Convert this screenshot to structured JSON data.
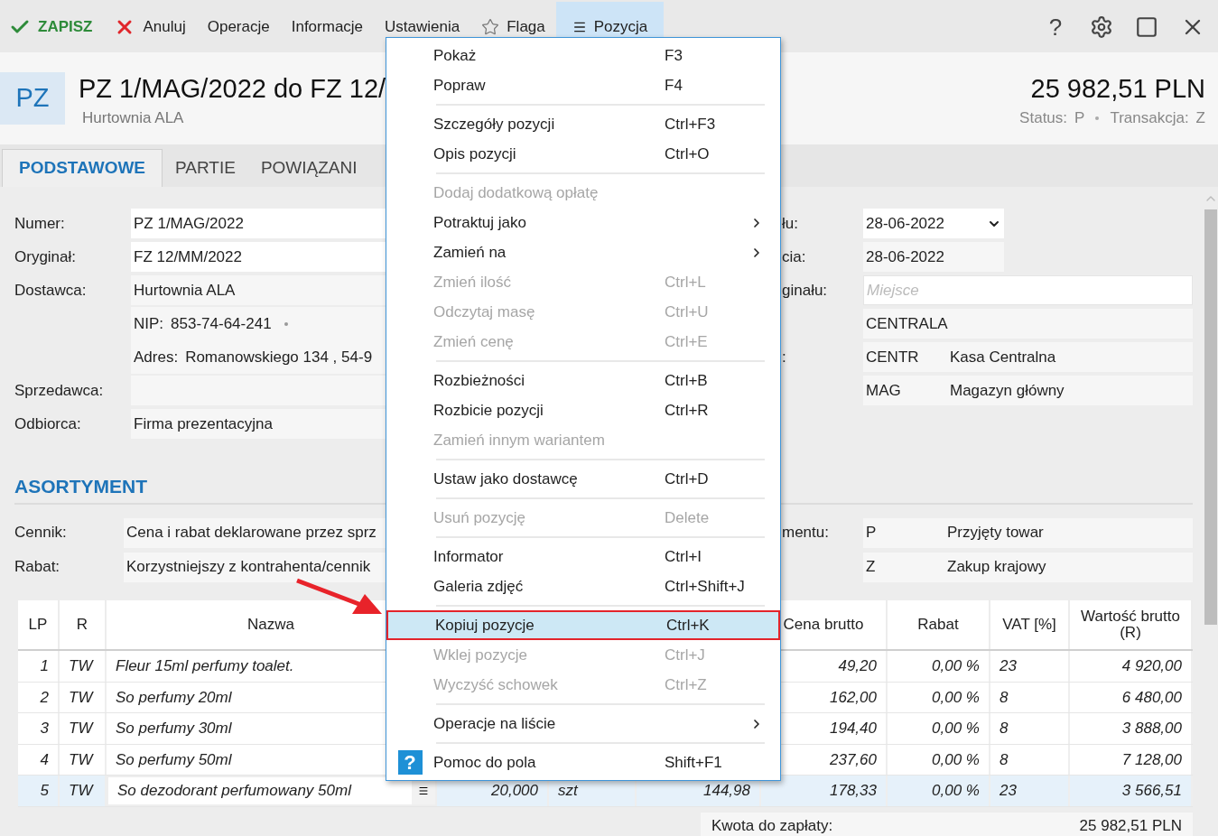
{
  "toolbar": {
    "items": [
      {
        "label": "ZAPISZ",
        "kind": "save",
        "selected": false
      },
      {
        "label": "Anuluj",
        "kind": "cancel",
        "selected": false
      },
      {
        "label": "Operacje",
        "kind": "plain",
        "selected": false
      },
      {
        "label": "Informacje",
        "kind": "plain",
        "selected": false
      },
      {
        "label": "Ustawienia",
        "kind": "plain",
        "selected": false
      },
      {
        "label": "Flaga",
        "kind": "flag",
        "selected": false
      },
      {
        "label": "Pozycja",
        "kind": "list",
        "selected": true
      }
    ],
    "help": "?"
  },
  "header": {
    "badge": "PZ",
    "title": "PZ 1/MAG/2022 do FZ 12/",
    "subtitle": "Hurtownia ALA",
    "total": "25 982,51 PLN",
    "status_label": "Status:",
    "status_value": "P",
    "transaction_label": "Transakcja:",
    "transaction_value": "Z"
  },
  "tabs": [
    {
      "label": "PODSTAWOWE",
      "selected": true
    },
    {
      "label": "PARTIE",
      "selected": false
    },
    {
      "label": "POWIĄZANI",
      "selected": false
    }
  ],
  "form_left": [
    {
      "label": "Numer:",
      "value": "PZ 1/MAG/2022",
      "kind": "input"
    },
    {
      "label": "Oryginał:",
      "value": "FZ 12/MM/2022",
      "kind": "input"
    },
    {
      "label": "Dostawca:",
      "value": "Hurtownia ALA",
      "kind": "readonly"
    },
    {
      "kind": "detail",
      "key": "NIP:",
      "value": "853-74-64-241",
      "dot": true
    },
    {
      "kind": "detail",
      "key": "Adres:",
      "value": "Romanowskiego 134 , 54-9",
      "dot": false
    },
    {
      "label": "Sprzedawca:",
      "kind": "readonly"
    },
    {
      "label": "Odbiorca:",
      "value": "Firma prezentacyjna",
      "kind": "readonly"
    }
  ],
  "form_right": [
    {
      "label": "łu:",
      "value": "28-06-2022",
      "kind": "date_picker"
    },
    {
      "label": "cia:",
      "value": "28-06-2022",
      "kind": "date"
    },
    {
      "label": "ginału:",
      "placeholder": "Miejsce",
      "kind": "input"
    },
    {
      "value": "CENTRALA",
      "kind": "readonly"
    },
    {
      "label": ":",
      "code": "CENTR",
      "value": "Kasa Centralna",
      "kind": "coded"
    },
    {
      "code": "MAG",
      "value": "Magazyn główny",
      "kind": "coded"
    }
  ],
  "section_title": "ASORTYMENT",
  "assortment_left": [
    {
      "label": "Cennik:",
      "value": "Cena i rabat deklarowane przez sprz"
    },
    {
      "label": "Rabat:",
      "value": "Korzystniejszy z kontrahenta/cennik"
    }
  ],
  "assortment_right": [
    {
      "label": "mentu:",
      "code": "P",
      "value": "Przyjęty towar"
    },
    {
      "code": "Z",
      "value": "Zakup krajowy"
    }
  ],
  "table": {
    "columns": {
      "lp": "LP",
      "r": "R",
      "name": "Nazwa",
      "gross_price": "Cena brutto",
      "discount": "Rabat",
      "vat": "VAT [%]",
      "gross_value": "Wartość brutto (R)"
    },
    "rows": [
      {
        "lp": "1",
        "r": "TW",
        "name": "Fleur 15ml perfumy toalet.",
        "gross_price": "49,20",
        "discount": "0,00 %",
        "vat": "23",
        "gross_value": "4 920,00",
        "selected": false
      },
      {
        "lp": "2",
        "r": "TW",
        "name": "So perfumy 20ml",
        "gross_price": "162,00",
        "discount": "0,00 %",
        "vat": "8",
        "gross_value": "6 480,00",
        "selected": false
      },
      {
        "lp": "3",
        "r": "TW",
        "name": "So perfumy 30ml",
        "gross_price": "194,40",
        "discount": "0,00 %",
        "vat": "8",
        "gross_value": "3 888,00",
        "selected": false
      },
      {
        "lp": "4",
        "r": "TW",
        "name": "So perfumy 50ml",
        "gross_price": "237,60",
        "discount": "0,00 %",
        "vat": "8",
        "gross_value": "7 128,00",
        "selected": false
      },
      {
        "lp": "5",
        "r": "TW",
        "name": "So dezodorant perfumowany 50ml",
        "column_4": "20,000",
        "column_5": "szt",
        "column_6": "144,98",
        "gross_price": "178,33",
        "discount": "0,00 %",
        "vat": "23",
        "gross_value": "3 566,51",
        "selected": true
      }
    ]
  },
  "footer": {
    "label": "Kwota do zapłaty:",
    "value": "25 982,51 PLN"
  },
  "context_menu": [
    {
      "kind": "item",
      "label": "Pokaż",
      "shortcut": "F3",
      "disabled": false,
      "submenu": false,
      "selected": false
    },
    {
      "kind": "item",
      "label": "Popraw",
      "shortcut": "F4",
      "disabled": false,
      "submenu": false,
      "selected": false
    },
    {
      "kind": "separator"
    },
    {
      "kind": "item",
      "label": "Szczegóły pozycji",
      "shortcut": "Ctrl+F3",
      "disabled": false,
      "submenu": false,
      "selected": false
    },
    {
      "kind": "item",
      "label": "Opis pozycji",
      "shortcut": "Ctrl+O",
      "disabled": false,
      "submenu": false,
      "selected": false
    },
    {
      "kind": "separator"
    },
    {
      "kind": "item",
      "label": "Dodaj dodatkową opłatę",
      "disabled": true,
      "submenu": false,
      "selected": false
    },
    {
      "kind": "item",
      "label": "Potraktuj jako",
      "disabled": false,
      "submenu": true,
      "selected": false
    },
    {
      "kind": "item",
      "label": "Zamień na",
      "disabled": false,
      "submenu": true,
      "selected": false
    },
    {
      "kind": "item",
      "label": "Zmień ilość",
      "shortcut": "Ctrl+L",
      "disabled": true,
      "submenu": false,
      "selected": false
    },
    {
      "kind": "item",
      "label": "Odczytaj masę",
      "shortcut": "Ctrl+U",
      "disabled": true,
      "submenu": false,
      "selected": false
    },
    {
      "kind": "item",
      "label": "Zmień cenę",
      "shortcut": "Ctrl+E",
      "disabled": true,
      "submenu": false,
      "selected": false
    },
    {
      "kind": "separator"
    },
    {
      "kind": "item",
      "label": "Rozbieżności",
      "shortcut": "Ctrl+B",
      "disabled": false,
      "submenu": false,
      "selected": false
    },
    {
      "kind": "item",
      "label": "Rozbicie pozycji",
      "shortcut": "Ctrl+R",
      "disabled": false,
      "submenu": false,
      "selected": false
    },
    {
      "kind": "item",
      "label": "Zamień innym wariantem",
      "disabled": true,
      "submenu": false,
      "selected": false
    },
    {
      "kind": "separator"
    },
    {
      "kind": "item",
      "label": "Ustaw jako dostawcę",
      "shortcut": "Ctrl+D",
      "disabled": false,
      "submenu": false,
      "selected": false
    },
    {
      "kind": "separator"
    },
    {
      "kind": "item",
      "label": "Usuń pozycję",
      "shortcut": "Delete",
      "disabled": true,
      "submenu": false,
      "selected": false
    },
    {
      "kind": "separator"
    },
    {
      "kind": "item",
      "label": "Informator",
      "shortcut": "Ctrl+I",
      "disabled": false,
      "submenu": false,
      "selected": false
    },
    {
      "kind": "item",
      "label": "Galeria zdjęć",
      "shortcut": "Ctrl+Shift+J",
      "disabled": false,
      "submenu": false,
      "selected": false
    },
    {
      "kind": "separator"
    },
    {
      "kind": "item",
      "label": "Kopiuj pozycje",
      "shortcut": "Ctrl+K",
      "disabled": false,
      "submenu": false,
      "selected": true
    },
    {
      "kind": "item",
      "label": "Wklej pozycje",
      "shortcut": "Ctrl+J",
      "disabled": true,
      "submenu": false,
      "selected": false
    },
    {
      "kind": "item",
      "label": "Wyczyść schowek",
      "shortcut": "Ctrl+Z",
      "disabled": true,
      "submenu": false,
      "selected": false
    },
    {
      "kind": "separator"
    },
    {
      "kind": "item",
      "label": "Operacje na liście",
      "disabled": false,
      "submenu": true,
      "selected": false
    },
    {
      "kind": "separator"
    },
    {
      "kind": "item",
      "label": "Pomoc do pola",
      "shortcut": "Shift+F1",
      "badge": "?",
      "disabled": false,
      "submenu": false,
      "selected": false
    }
  ]
}
